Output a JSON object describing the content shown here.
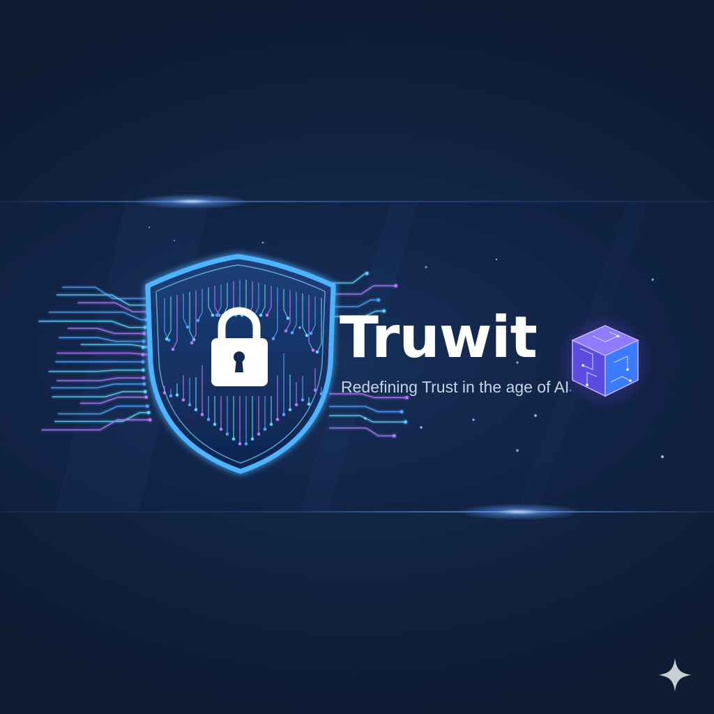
{
  "brand": {
    "name": "Truwit",
    "tagline": "Redefining Trust in the age of AI"
  },
  "icons": {
    "shield": "shield-circuit-icon",
    "lock": "padlock-icon",
    "cube": "cube-icon",
    "sparkle": "sparkle-icon"
  },
  "colors": {
    "background": "#0d1b33",
    "banner": "#132a4f",
    "accent_blue": "#4fa3ff",
    "accent_cyan": "#5fd4ff",
    "accent_violet": "#b27cff",
    "title": "#ffffff",
    "tagline": "#c9d3e6"
  }
}
